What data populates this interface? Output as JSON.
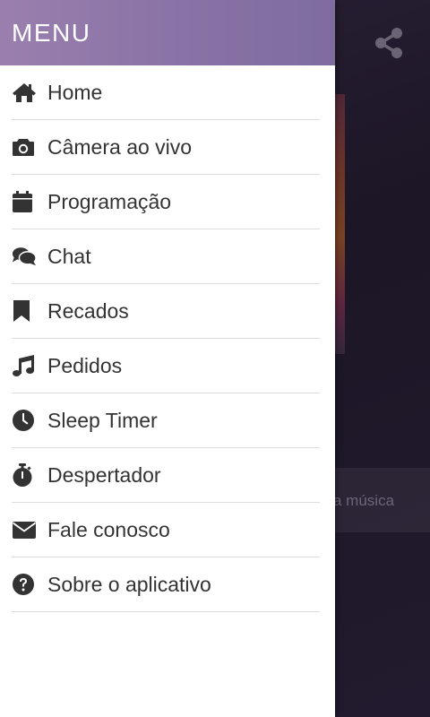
{
  "drawer": {
    "title": "MENU",
    "items": [
      {
        "label": "Home",
        "icon": "home-icon"
      },
      {
        "label": "Câmera ao vivo",
        "icon": "camera-icon"
      },
      {
        "label": "Programação",
        "icon": "calendar-icon"
      },
      {
        "label": "Chat",
        "icon": "chat-icon"
      },
      {
        "label": "Recados",
        "icon": "bookmark-icon"
      },
      {
        "label": "Pedidos",
        "icon": "music-note-icon"
      },
      {
        "label": "Sleep Timer",
        "icon": "clock-icon"
      },
      {
        "label": "Despertador",
        "icon": "stopwatch-icon"
      },
      {
        "label": "Fale conosco",
        "icon": "envelope-icon"
      },
      {
        "label": "Sobre o aplicativo",
        "icon": "question-circle-icon"
      }
    ]
  },
  "background": {
    "share_icon": "share-icon",
    "bar_text": "a música"
  },
  "colors": {
    "header_gradient_start": "#9a7fae",
    "header_gradient_end": "#7f6c9e",
    "icon": "#333333",
    "text": "#333333",
    "divider": "#dcdcdc"
  }
}
